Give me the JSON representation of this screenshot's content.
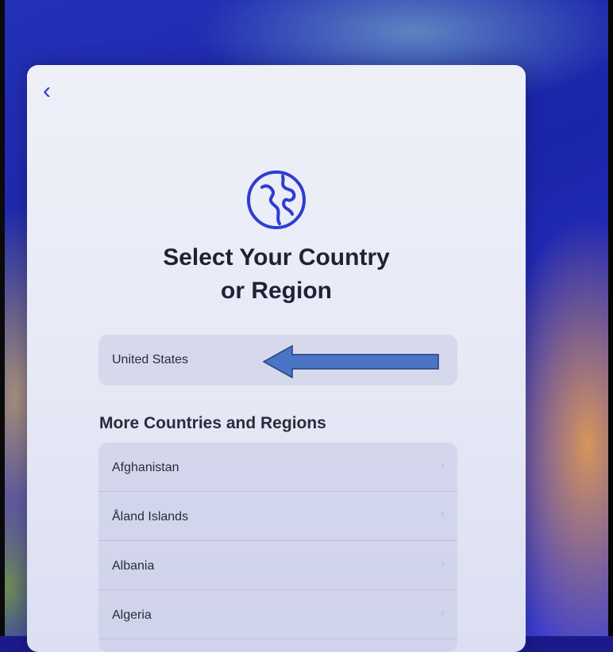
{
  "colors": {
    "accent": "#2f3ccf",
    "arrow_fill": "#4a74c4",
    "arrow_stroke": "#253e7a"
  },
  "nav": {
    "back_icon": "chevron-left-icon",
    "back_glyph": "‹"
  },
  "header": {
    "icon": "globe-icon",
    "title_line1": "Select Your Country",
    "title_line2": "or Region"
  },
  "selected": {
    "label": "United States"
  },
  "more": {
    "header": "More Countries and Regions",
    "items": [
      {
        "label": "Afghanistan"
      },
      {
        "label": "Åland Islands"
      },
      {
        "label": "Albania"
      },
      {
        "label": "Algeria"
      }
    ]
  }
}
